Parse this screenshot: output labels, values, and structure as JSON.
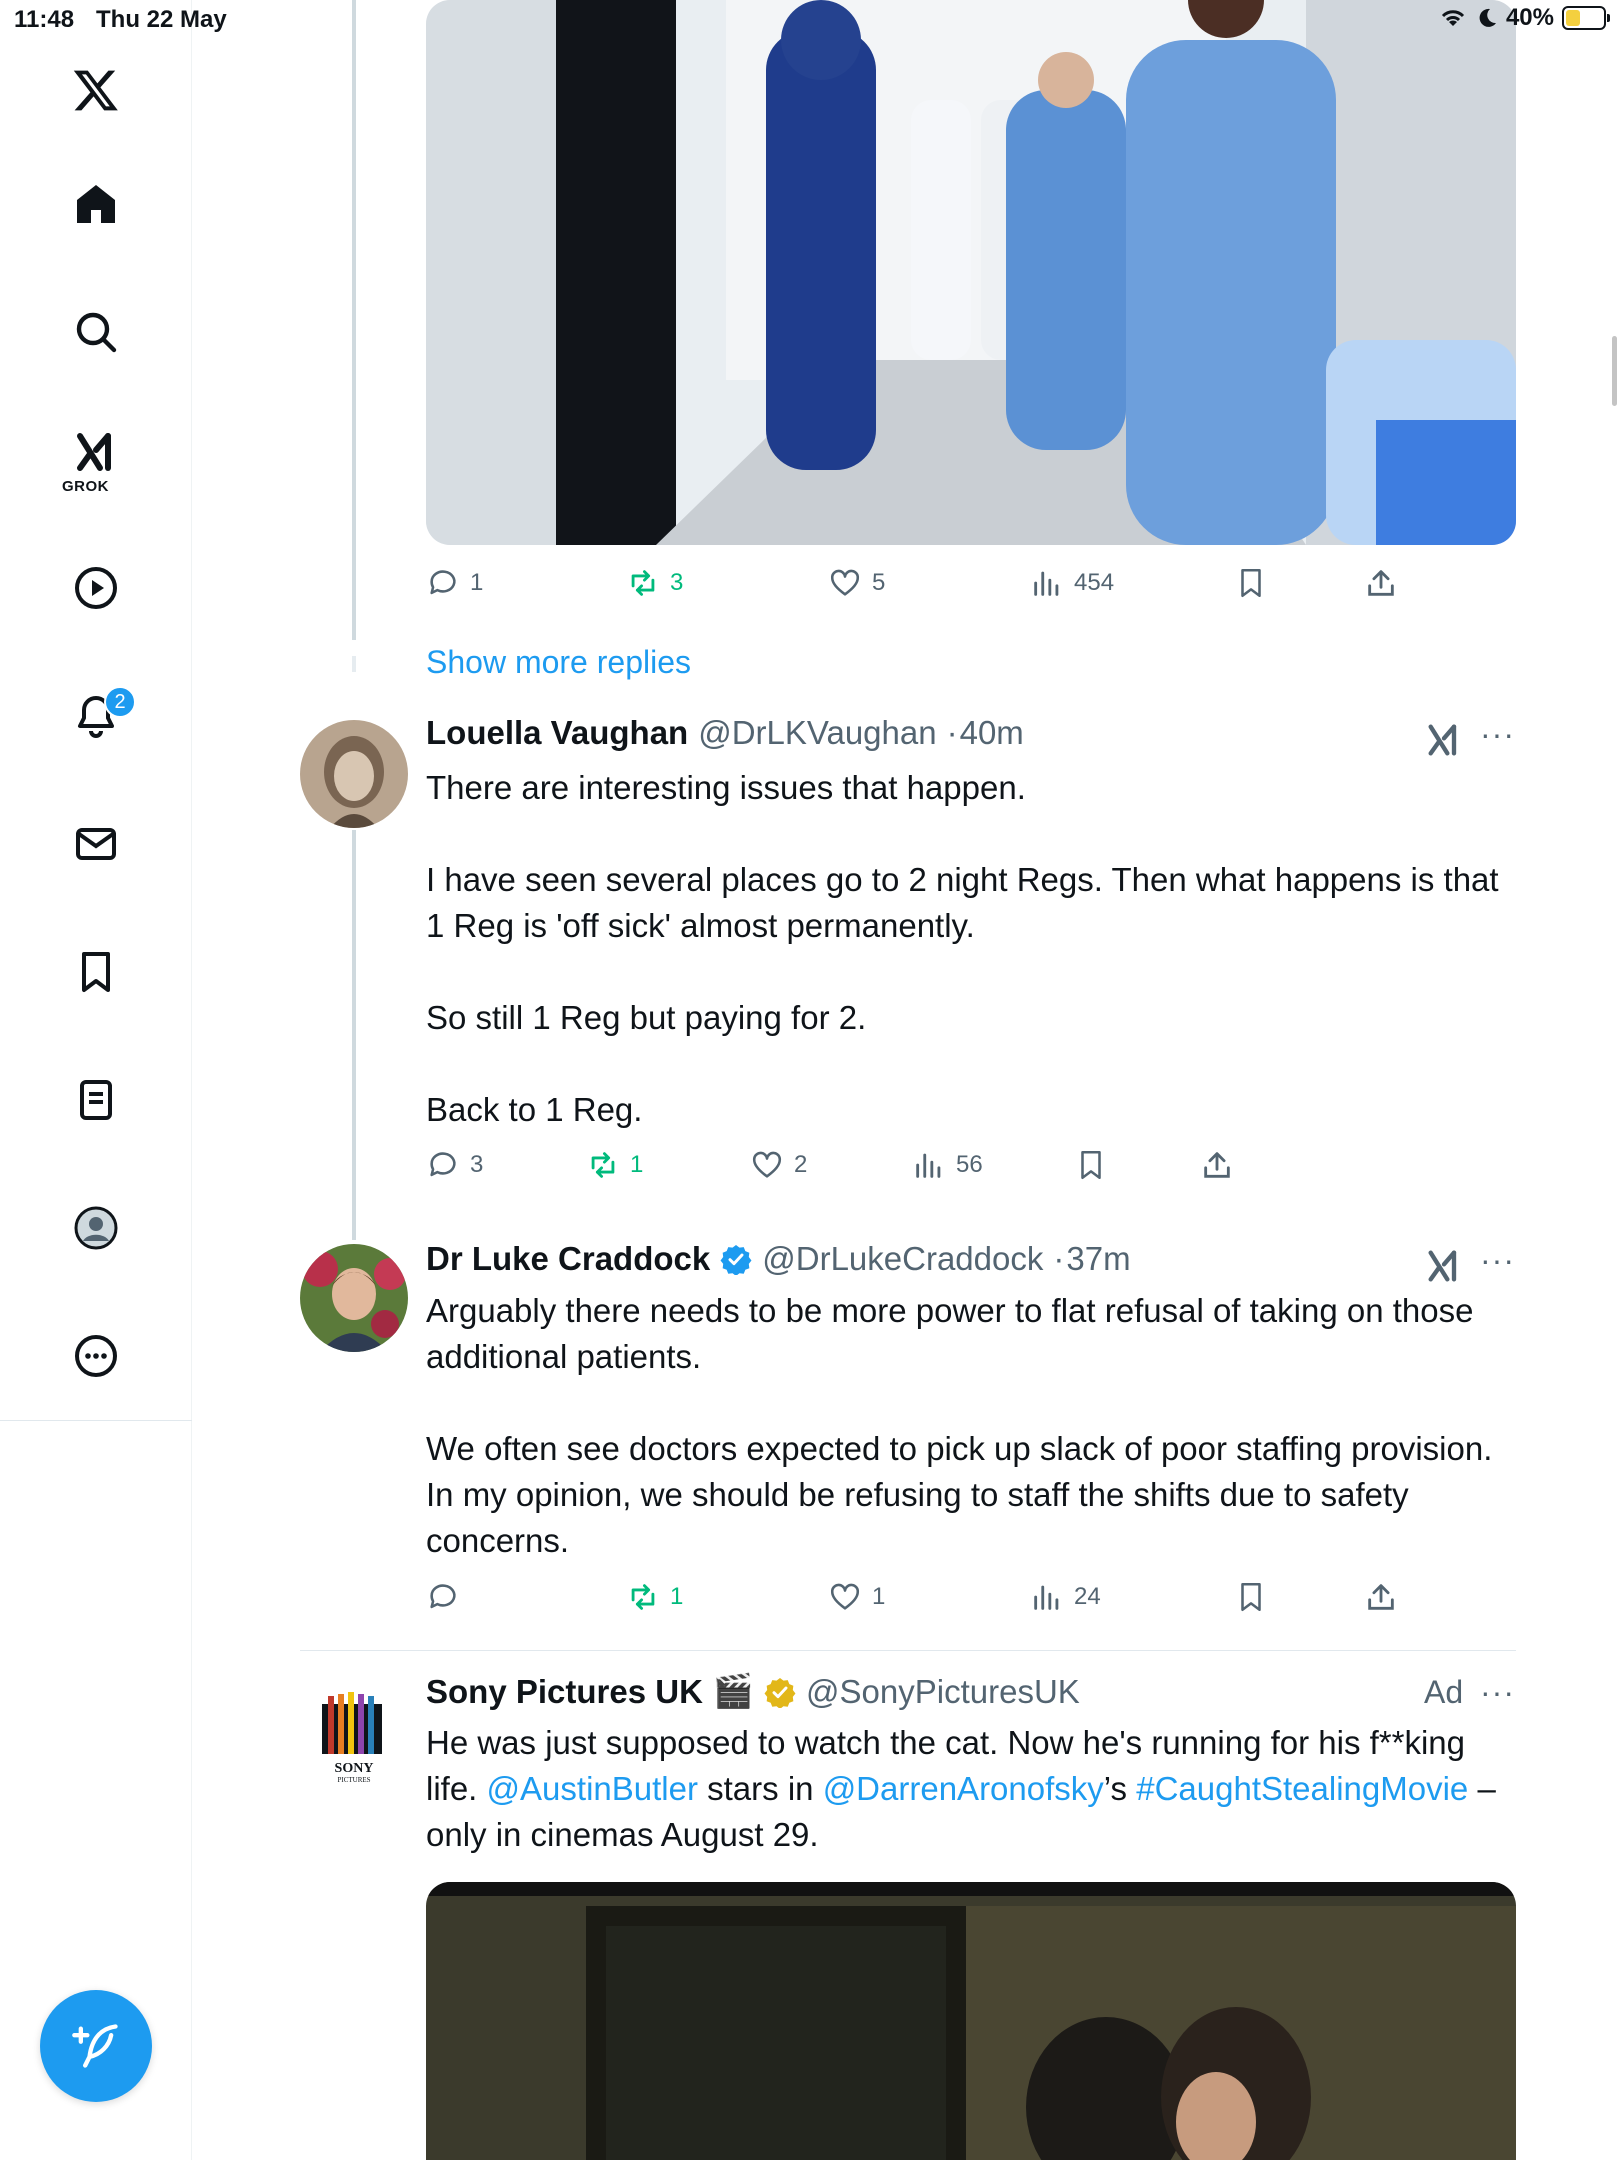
{
  "status_bar": {
    "time": "11:48",
    "date": "Thu 22 May",
    "battery": "40%",
    "battery_level": 0.4
  },
  "sidebar": {
    "logo": "x-logo-icon",
    "items": [
      {
        "name": "home",
        "icon": "home-icon"
      },
      {
        "name": "explore",
        "icon": "search-icon"
      },
      {
        "name": "grok",
        "icon": "grok-icon",
        "label": "GROK"
      },
      {
        "name": "video",
        "icon": "play-icon"
      },
      {
        "name": "notifications",
        "icon": "bell-icon",
        "badge": "2"
      },
      {
        "name": "messages",
        "icon": "mail-icon"
      },
      {
        "name": "bookmarks",
        "icon": "bookmark-icon"
      },
      {
        "name": "lists",
        "icon": "list-icon"
      },
      {
        "name": "profile",
        "icon": "profile-icon"
      },
      {
        "name": "more",
        "icon": "more-icon"
      }
    ],
    "compose_icon": "compose-icon"
  },
  "top_tweet": {
    "actions": {
      "replies": "1",
      "reposts": "3",
      "likes": "5",
      "views": "454"
    }
  },
  "show_more_replies": "Show more replies",
  "tweets": [
    {
      "name": "Louella Vaughan",
      "handle": "@DrLKVaughan",
      "time": "40m",
      "lines": [
        "There are interesting issues that happen.",
        "I have seen several places go to 2 night Regs. Then what happens is that 1 Reg is 'off sick' almost permanently.",
        "So still 1 Reg but paying for 2.",
        "Back to 1 Reg."
      ],
      "actions": {
        "replies": "3",
        "reposts": "1",
        "likes": "2",
        "views": "56"
      }
    },
    {
      "name": "Dr Luke Craddock",
      "handle": "@DrLukeCraddock",
      "time": "37m",
      "verified": true,
      "lines": [
        "Arguably there needs to be more power to flat refusal of taking on those additional patients.",
        "We often see doctors expected to pick up slack of poor staffing provision. In my opinion, we should be refusing to staff the shifts due to safety concerns."
      ],
      "actions": {
        "replies": "",
        "reposts": "1",
        "likes": "1",
        "views": "24"
      }
    }
  ],
  "ad": {
    "name": "Sony Pictures UK",
    "emoji": "🎬",
    "handle": "@SonyPicturesUK",
    "label": "Ad",
    "text_1": "He was just supposed to watch the cat. Now he's running for his f**king life.",
    "mention_1": "@AustinButler",
    "text_2": "stars in",
    "mention_2": "@DarrenAronofsky",
    "text_3": "’s",
    "hashtag": "#CaughtStealingMovie",
    "text_4": "– only in cinemas August 29.",
    "logo_text": "SONY",
    "logo_subtext": "PICTURES"
  },
  "colors": {
    "accent": "#1d9bf0",
    "repost_green": "#00ba7c",
    "secondary_text": "#536471",
    "verified_gold": "#e2b719"
  }
}
